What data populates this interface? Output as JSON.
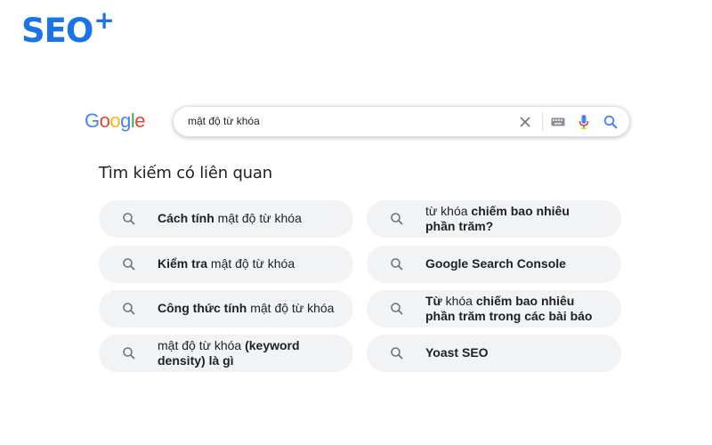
{
  "brand": {
    "name": "SEO",
    "suffix": "+"
  },
  "google": {
    "logo": "Google"
  },
  "search": {
    "query": "mật độ từ khóa"
  },
  "related": {
    "heading": "Tìm kiếm có liên quan",
    "left": [
      {
        "bold": "Cách tính",
        "rest": " mật độ từ khóa"
      },
      {
        "bold": "Kiểm tra",
        "rest": " mật độ từ khóa"
      },
      {
        "bold": "Công thức tính",
        "rest": " mật độ từ khóa"
      },
      {
        "plain": "mật độ từ khóa ",
        "bold": "(keyword density) là gì"
      }
    ],
    "right": [
      {
        "plain": "từ khóa ",
        "bold": "chiếm bao nhiêu phần trăm?"
      },
      {
        "bold": "Google Search Console"
      },
      {
        "bold": "Từ",
        "plain": " khóa ",
        "bold2": "chiếm bao nhiêu phần trăm trong các bài báo"
      },
      {
        "bold": "Yoast SEO"
      }
    ]
  },
  "colors": {
    "brand": "#1a73e8",
    "chip_bg": "#f1f3f4",
    "text": "#202124"
  },
  "icons": [
    "clear-icon",
    "keyboard-icon",
    "microphone-icon",
    "search-icon",
    "magnifier-icon"
  ]
}
